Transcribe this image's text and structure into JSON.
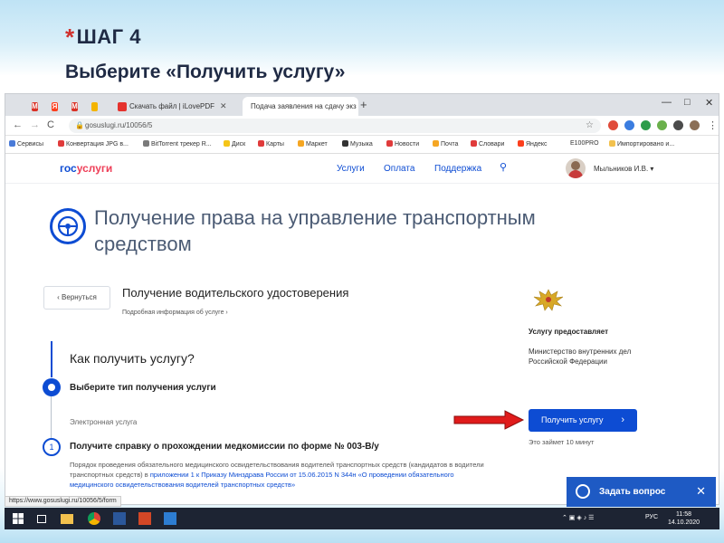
{
  "slide": {
    "asterisk": "*",
    "step": "ШАГ 4",
    "subtitle": "Выберите «Получить услугу»"
  },
  "browser": {
    "tabs": [
      {
        "label": "",
        "icon": "mail-icon",
        "color": "#d93025"
      },
      {
        "label": "",
        "icon": "yandex-icon",
        "color": "#fc3f1d"
      },
      {
        "label": "",
        "icon": "mail-icon",
        "color": "#d93025"
      },
      {
        "label": "Скачать файл | iLovePDF",
        "icon": "ilovepdf-icon",
        "color": "#e5322d"
      },
      {
        "label": "Подача заявления на сдачу экз",
        "icon": "gosuslugi-icon",
        "color": "#0d4cd3",
        "active": true
      }
    ],
    "new_tab": "+",
    "window_controls": [
      "—",
      "□",
      "✕"
    ],
    "nav": {
      "back": "←",
      "forward": "→",
      "reload": "C"
    },
    "url": "gosuslugi.ru/10056/5",
    "bookmarks": [
      "Сервисы",
      "Конвертация JPG в...",
      "BitTorrent трекер R...",
      "Диск",
      "Карты",
      "Маркет",
      "Музыка",
      "Новости",
      "Почта",
      "Словари",
      "Яндекс",
      "E100PRO",
      "Импортировано и..."
    ],
    "status_url": "https://www.gosuslugi.ru/10056/5/form"
  },
  "site": {
    "logo_main": "гос",
    "logo_accent": "услуги",
    "nav": [
      "Услуги",
      "Оплата",
      "Поддержка"
    ],
    "user_name": "Мыльников И.В.",
    "user_caret": "▾"
  },
  "service": {
    "title": "Получение права на управление транспортным средством",
    "back_label": "‹  Вернуться",
    "subservice": "Получение водительского удостоверения",
    "more_info": "Подробная информация об услуге  ›",
    "how_to": "Как получить услугу?",
    "step1": "Выберите тип получения услуги",
    "e_service": "Электронная услуга",
    "step2_num": "1",
    "step2": "Получите справку о прохождении медкомиссии по форме № 003-В/у",
    "step2_desc_a": "Порядок проведения обязательного медицинского освидетельствования водителей транспортных средств (кандидатов в водители транспортных средств) в ",
    "step2_desc_link": "приложении 1 к Приказу Минздрава России от 15.06.2015 N 344н «О проведении обязательного медицинского освидетельствования водителей транспортных средств»",
    "provider_label": "Услугу предоставляет",
    "provider_name": "Министерство внутренних дел Российской Федерации",
    "get_button": "Получить услугу",
    "get_button_chevron": "›",
    "time_note": "Это займет 10 минут"
  },
  "widget": {
    "label": "Задать вопрос",
    "close": "✕"
  },
  "taskbar": {
    "lang": "РУС",
    "time": "11:58",
    "date": "14.10.2020"
  },
  "colors": {
    "brand_blue": "#0d4cd3",
    "brand_red": "#ee3f58",
    "arrow_red": "#e01b1b"
  }
}
